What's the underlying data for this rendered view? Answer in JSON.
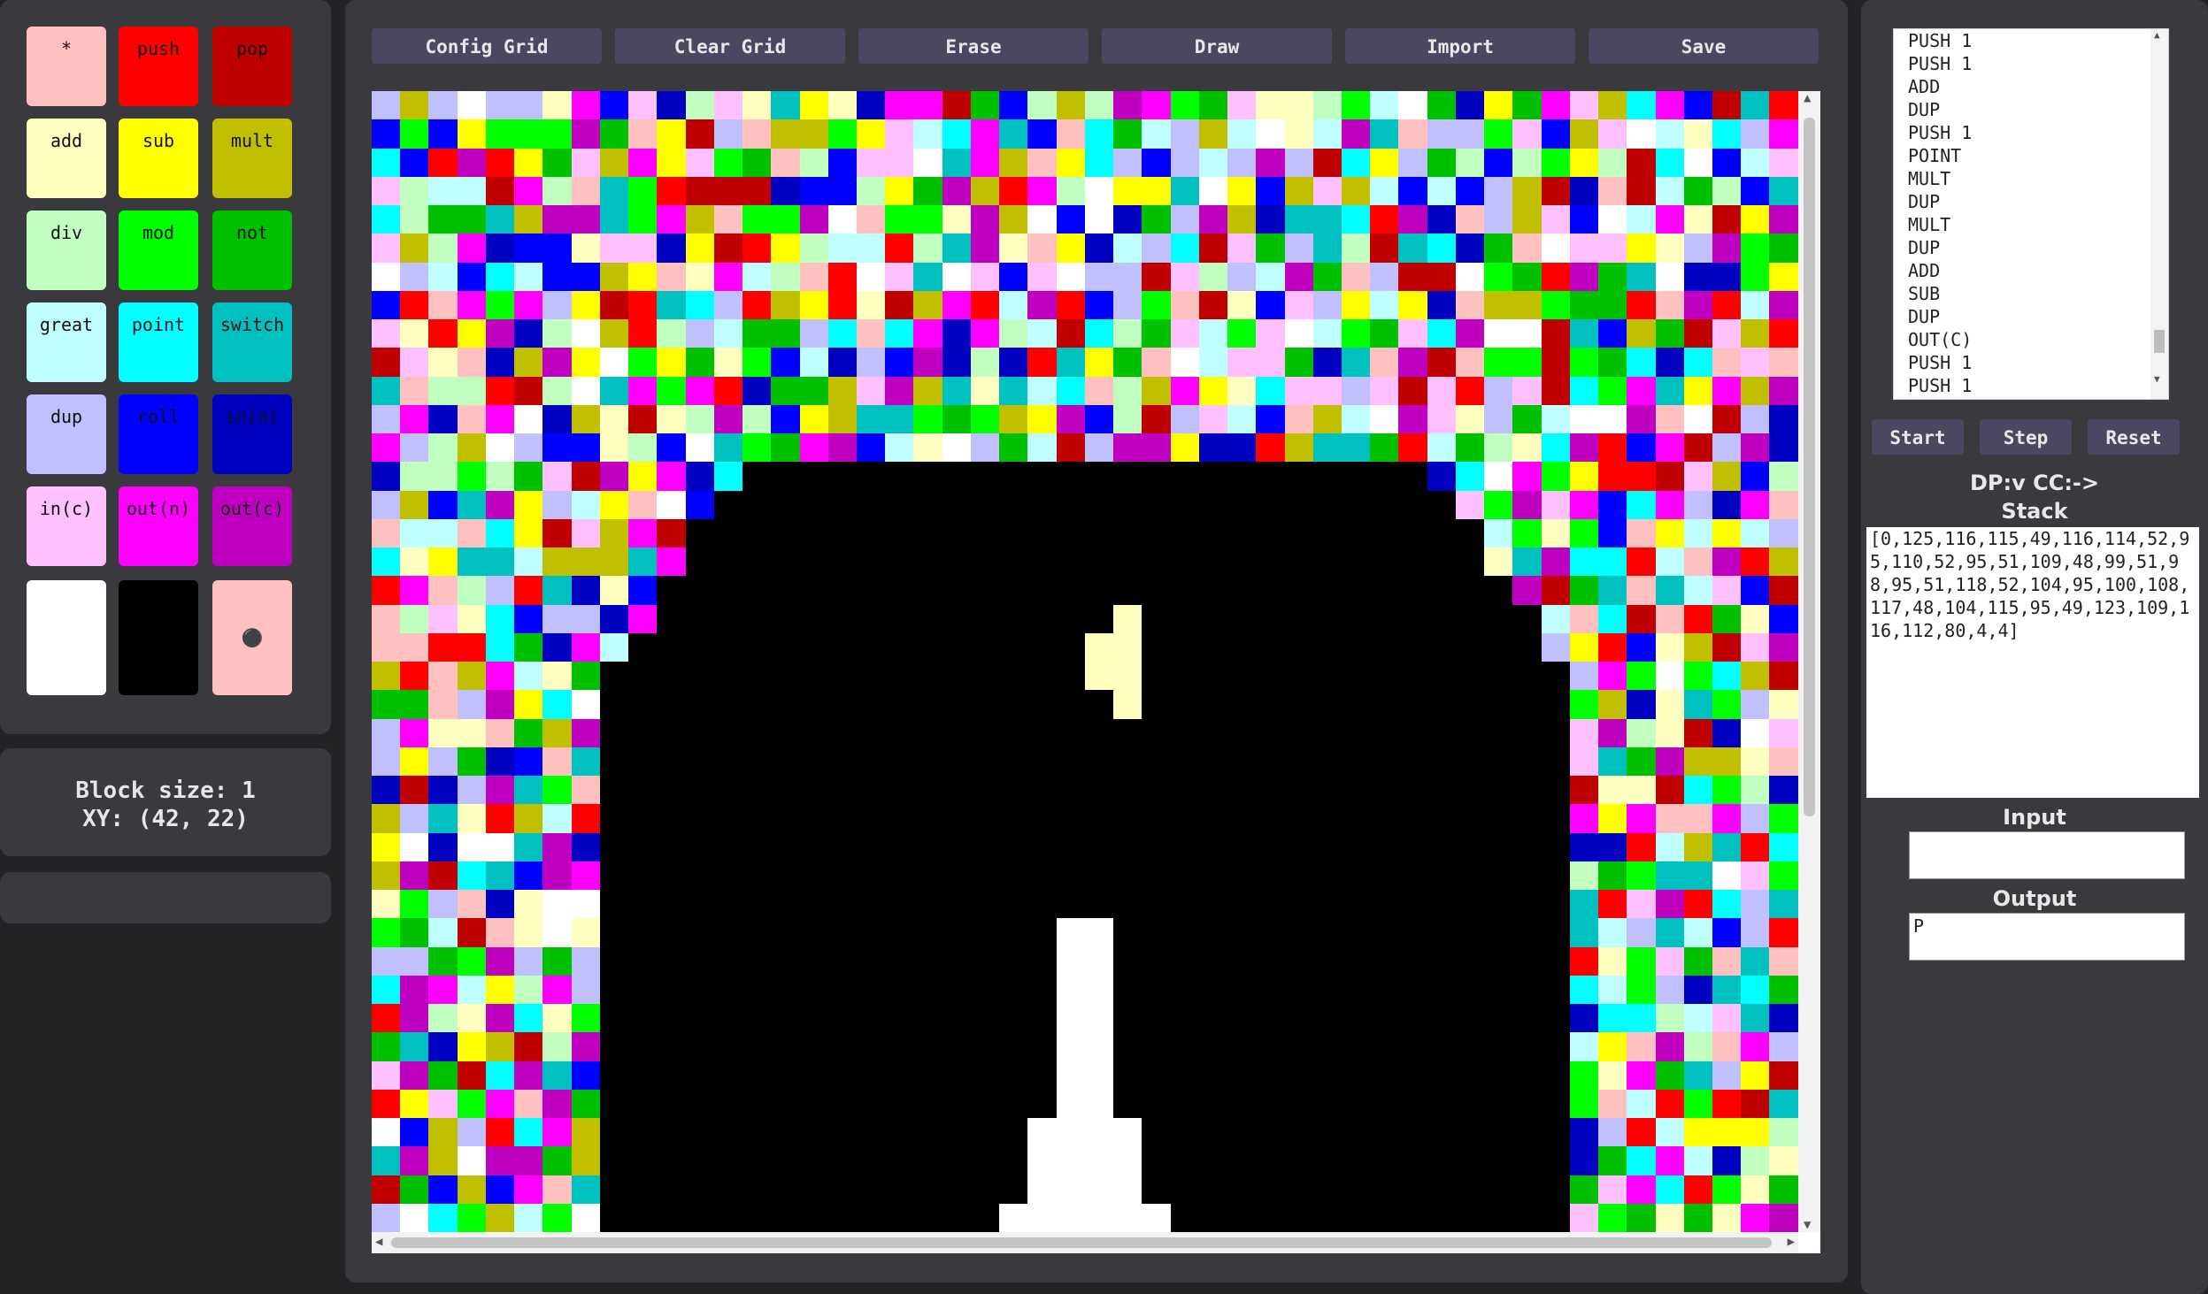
{
  "palette": {
    "buttons": [
      {
        "label": "*",
        "color": "#ffc0c0"
      },
      {
        "label": "push",
        "color": "#ff0000"
      },
      {
        "label": "pop",
        "color": "#c00000"
      },
      {
        "label": "add",
        "color": "#ffffc0"
      },
      {
        "label": "sub",
        "color": "#ffff00"
      },
      {
        "label": "mult",
        "color": "#c0c000"
      },
      {
        "label": "div",
        "color": "#c0ffc0"
      },
      {
        "label": "mod",
        "color": "#00ff00"
      },
      {
        "label": "not",
        "color": "#00c000"
      },
      {
        "label": "great",
        "color": "#c0ffff"
      },
      {
        "label": "point",
        "color": "#00ffff"
      },
      {
        "label": "switch",
        "color": "#00c0c0"
      },
      {
        "label": "dup",
        "color": "#c0c0ff"
      },
      {
        "label": "roll",
        "color": "#0000ff"
      },
      {
        "label": "in(n)",
        "color": "#0000c0"
      },
      {
        "label": "in(c)",
        "color": "#ffc0ff"
      },
      {
        "label": "out(n)",
        "color": "#ff00ff"
      },
      {
        "label": "out(c)",
        "color": "#c000c0"
      }
    ],
    "white_color": "#ffffff",
    "black_color": "#000000",
    "fill_icon": "paint-bucket-icon",
    "fill_color": "#ffc0c0"
  },
  "info": {
    "block_size": "Block size: 1",
    "xy": "XY: (42, 22)"
  },
  "toolbar": [
    "Config Grid",
    "Clear Grid",
    "Erase",
    "Draw",
    "Import",
    "Save"
  ],
  "grid": {
    "cols": 50,
    "rows": 40,
    "seed": 12345
  },
  "program": [
    "PUSH 1",
    "PUSH 1",
    "ADD",
    "DUP",
    "PUSH 1",
    "POINT",
    "MULT",
    "DUP",
    "MULT",
    "DUP",
    "ADD",
    "SUB",
    "DUP",
    "OUT(C)",
    "PUSH 1",
    "PUSH 1"
  ],
  "controls": {
    "start": "Start",
    "step": "Step",
    "reset": "Reset"
  },
  "dp_cc": "DP:v CC:->",
  "stack_label": "Stack",
  "stack_value": "[0,125,116,115,49,116,114,52,95,110,52,95,51,109,48,99,51,98,95,51,118,52,104,95,100,108,117,48,104,115,95,49,123,109,116,112,80,4,4]",
  "input_label": "Input",
  "input_value": "",
  "output_label": "Output",
  "output_value": "P"
}
